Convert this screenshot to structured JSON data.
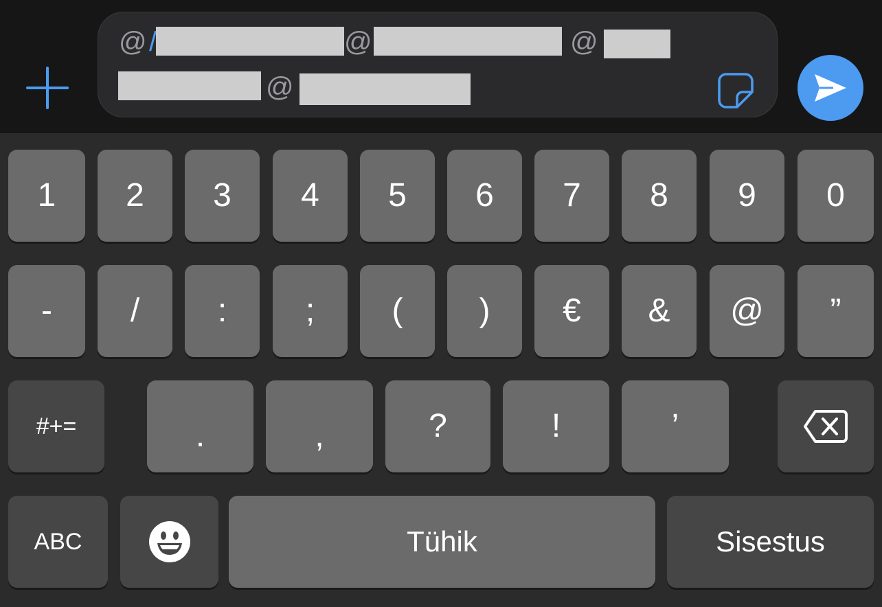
{
  "compose": {
    "mention_symbol": "@",
    "caret_fragment": "/"
  },
  "keyboard": {
    "row1": [
      "1",
      "2",
      "3",
      "4",
      "5",
      "6",
      "7",
      "8",
      "9",
      "0"
    ],
    "row2": [
      "-",
      "/",
      ":",
      ";",
      "(",
      ")",
      "€",
      "&",
      "@",
      "”"
    ],
    "row3": {
      "mode_key": "#+=",
      "keys": [
        ".",
        ",",
        "?",
        "!",
        "’"
      ]
    },
    "row4": {
      "abc_key": "ABC",
      "space_key": "Tühik",
      "return_key": "Sisestus"
    }
  },
  "icons": {
    "attach": "plus-icon",
    "sticker": "sticker-icon",
    "send": "send-arrow-icon",
    "delete": "backspace-icon",
    "emoji": "emoji-face-icon"
  },
  "colors": {
    "accent": "#4c9bf0",
    "key": "#6b6b6b",
    "key_dark": "#464646",
    "background": "#2b2b2b",
    "bar": "#161616"
  }
}
